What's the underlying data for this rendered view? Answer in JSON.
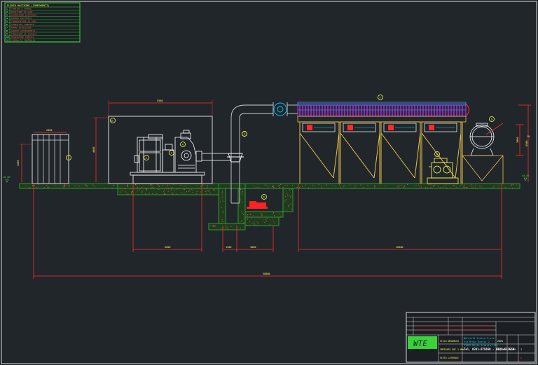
{
  "drawing": {
    "background": "#21262b",
    "colors": {
      "frame": "#d9d9d9",
      "dimension": "#ff2b2b",
      "equipment": "#ffffff",
      "foundation": "#2f9a2f",
      "structure": "#e8c24a",
      "condenser_fins": "#b23bd6",
      "pipe": "#cfcfcf",
      "pump": "#ff2222",
      "legend_green": "#39d23a",
      "title_yellow": "#ffff55",
      "logo_bg": "#39d23a"
    }
  },
  "legend": {
    "title": "ELENCO MACCHINE (COMPONENTI)",
    "rows": [
      {
        "num": "1",
        "text": "TURBINA A VAPORE"
      },
      {
        "num": "2",
        "text": "RIDUTTORE DI GIRI"
      },
      {
        "num": "3",
        "text": "GENERATORE ELETTRICO"
      },
      {
        "num": "4",
        "text": "QUADRO ELETTRICO"
      },
      {
        "num": "5",
        "text": "CONDENSATORE AD ARIA"
      },
      {
        "num": "6",
        "text": "SERBATOIO CONDENSE"
      },
      {
        "num": "7",
        "text": "POMPE ESTRAZIONE"
      },
      {
        "num": "8",
        "text": "GRUPPO OLEODINAMICO"
      },
      {
        "num": "9",
        "text": "TUBAZIONE DI SCARICO"
      },
      {
        "num": "10",
        "text": "DEGASATORE TERMICO"
      },
      {
        "num": "11",
        "text": "CABINA DI CONTROLLO"
      }
    ]
  },
  "labels": {
    "balloon_1": "1",
    "balloon_2": "2",
    "balloon_3": "3",
    "balloon_4": "4",
    "balloon_5": "5",
    "balloon_6": "6",
    "balloon_7": "7",
    "balloon_8": "8",
    "balloon_9": "9",
    "balloon_10": "10",
    "balloon_11": "11"
  },
  "dimensions": {
    "top_building": "5500",
    "small_building": "2000",
    "building_height": "4000",
    "tank_height": "3200",
    "turbine_room": "5000",
    "pit_a": "1500",
    "pit_b": "3000",
    "condenser_span": "16500",
    "total_length": "38000",
    "level_mark": "±0.00",
    "right_height": "3000",
    "condenser_height": "6500"
  },
  "title_block": {
    "company_line1": "Wärtsilä Italia S.p.A.",
    "company_line2": "Via Bruno Buozzi 2",
    "company_line3": "21052 Busto Arsizio (VA)",
    "company_line4": "Tel. 0331-675660 - 0331-653568",
    "logo": "WTE",
    "drawing_no": "2001",
    "date": "05/08",
    "scale": "1:100",
    "sheet": "1",
    "rev": "A",
    "desc1": "CICLO ORGANICO",
    "desc2": "IMPIANTO ORC 1 MWe",
    "desc3": "VISTA LATERALE"
  }
}
